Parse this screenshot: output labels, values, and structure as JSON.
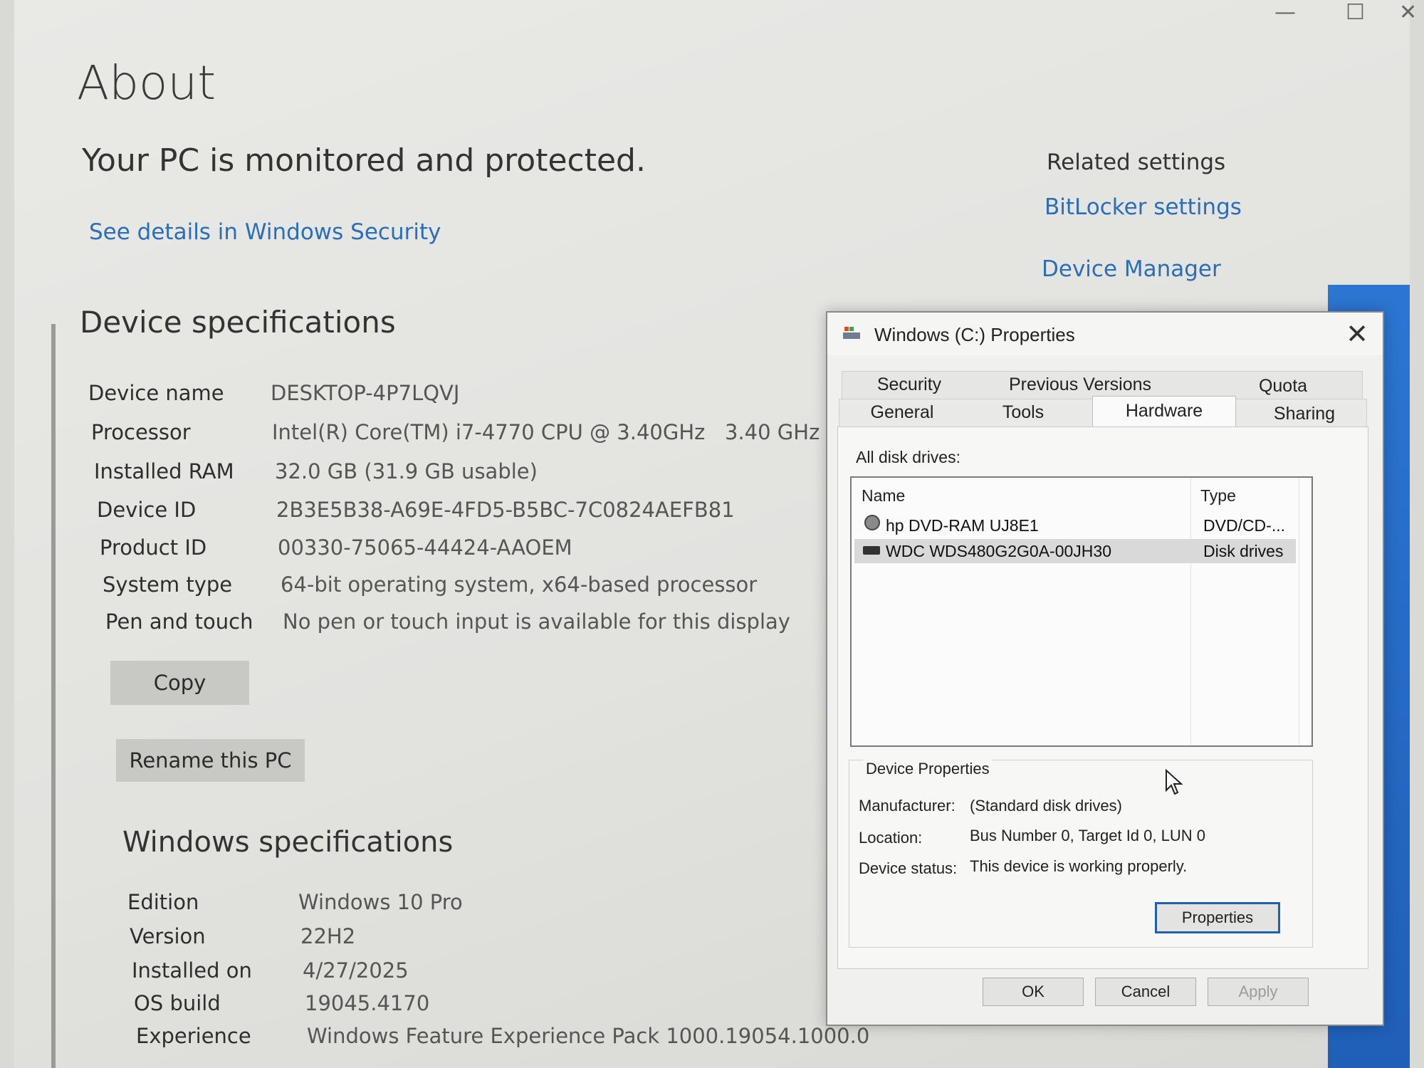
{
  "page": {
    "title": "About",
    "protection_status": "Your PC is monitored and protected.",
    "security_link": "See details in Windows Security"
  },
  "related_settings": {
    "title": "Related settings",
    "links": [
      "BitLocker settings",
      "Device Manager"
    ]
  },
  "device_specs": {
    "title": "Device specifications",
    "rows": [
      {
        "label": "Device name",
        "value": "DESKTOP-4P7LQVJ"
      },
      {
        "label": "Processor",
        "value": "Intel(R) Core(TM) i7-4770 CPU @ 3.40GHz   3.40 GHz"
      },
      {
        "label": "Installed RAM",
        "value": "32.0 GB (31.9 GB usable)"
      },
      {
        "label": "Device ID",
        "value": "2B3E5B38-A69E-4FD5-B5BC-7C0824AEFB81"
      },
      {
        "label": "Product ID",
        "value": "00330-75065-44424-AAOEM"
      },
      {
        "label": "System type",
        "value": "64-bit operating system, x64-based processor"
      },
      {
        "label": "Pen and touch",
        "value": "No pen or touch input is available for this display"
      }
    ],
    "copy_button": "Copy",
    "rename_button": "Rename this PC"
  },
  "windows_specs": {
    "title": "Windows specifications",
    "rows": [
      {
        "label": "Edition",
        "value": "Windows 10 Pro"
      },
      {
        "label": "Version",
        "value": "22H2"
      },
      {
        "label": "Installed on",
        "value": "4/27/2025"
      },
      {
        "label": "OS build",
        "value": "19045.4170"
      },
      {
        "label": "Experience",
        "value": "Windows Feature Experience Pack 1000.19054.1000.0"
      }
    ]
  },
  "dialog": {
    "title": "Windows (C:) Properties",
    "tabs_back": [
      "Security",
      "Previous Versions",
      "Quota"
    ],
    "tabs_front": [
      "General",
      "Tools",
      "Hardware",
      "Sharing"
    ],
    "active_tab": "Hardware",
    "all_disk_label": "All disk drives:",
    "columns": [
      "Name",
      "Type"
    ],
    "drives": [
      {
        "name": "hp DVD-RAM UJ8E1",
        "type": "DVD/CD-...",
        "icon": "dvd-drive-icon"
      },
      {
        "name": "WDC WDS480G2G0A-00JH30",
        "type": "Disk drives",
        "icon": "disk-drive-icon"
      }
    ],
    "device_properties": {
      "title": "Device Properties",
      "manufacturer_label": "Manufacturer:",
      "manufacturer": "(Standard disk drives)",
      "location_label": "Location:",
      "location": "Bus Number 0, Target Id 0, LUN 0",
      "status_label": "Device status:",
      "status": "This device is working properly.",
      "properties_button": "Properties"
    },
    "buttons": {
      "ok": "OK",
      "cancel": "Cancel",
      "apply": "Apply"
    }
  },
  "window_controls": {
    "minimize": "—",
    "maximize": "☐",
    "close": "✕"
  },
  "colors": {
    "link": "#2a6db8",
    "accent": "#1f5fb8"
  }
}
